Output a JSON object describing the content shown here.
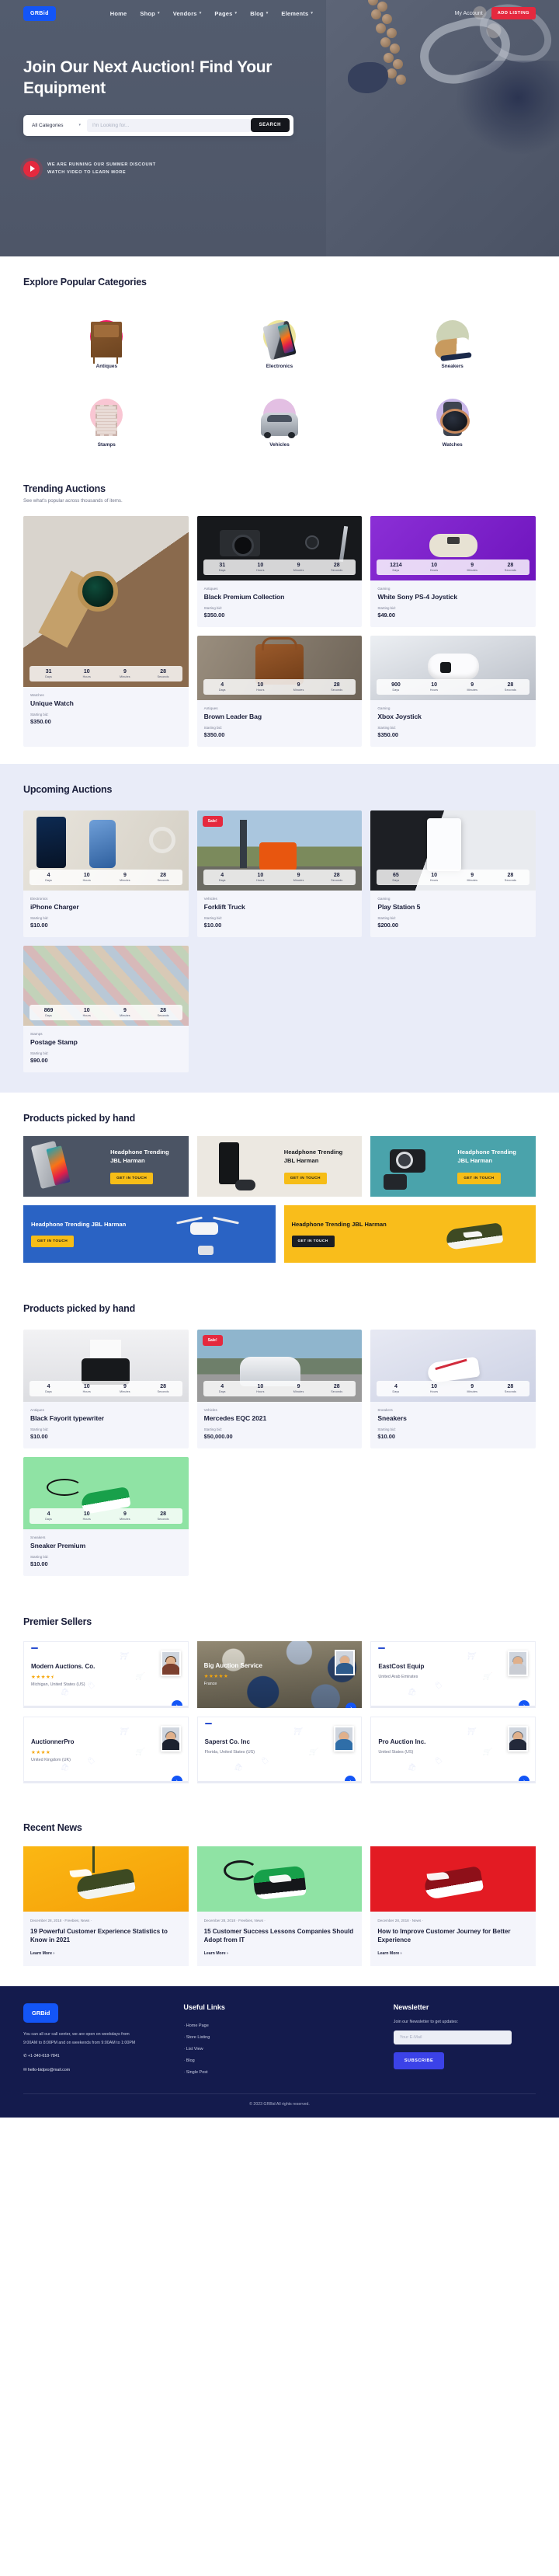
{
  "header": {
    "logo": "GRBid",
    "nav": [
      {
        "label": "Home",
        "caret": false
      },
      {
        "label": "Shop",
        "caret": true
      },
      {
        "label": "Vendors",
        "caret": true
      },
      {
        "label": "Pages",
        "caret": true
      },
      {
        "label": "Blog",
        "caret": true
      },
      {
        "label": "Elements",
        "caret": true
      }
    ],
    "account_label": "My Account",
    "add_listing_label": "ADD LISTING"
  },
  "hero": {
    "title": "Join Our Next Auction! Find Your Equipment",
    "category_select": "All Categories",
    "search_placeholder": "I'm Looking for...",
    "search_value": "",
    "search_button": "SEARCH",
    "video_line1": "WE ARE RUNNING OUR SUMMER DISCOUNT",
    "video_line2": "WATCH VIDEO TO LEARN MORE"
  },
  "categories": {
    "title": "Explore Popular Categories",
    "items": [
      {
        "label": "Antiques",
        "art": "desk",
        "blob": "#f5176a"
      },
      {
        "label": "Electronics",
        "art": "tablet",
        "blob": "#ece49a"
      },
      {
        "label": "Sneakers",
        "art": "sneaker",
        "blob": "#cdd3b6"
      },
      {
        "label": "Stamps",
        "art": "stamp",
        "blob": "#f9c6d3"
      },
      {
        "label": "Vehicles",
        "art": "car",
        "blob": "#e3bfe3"
      },
      {
        "label": "Watches",
        "art": "watch",
        "blob": "#c8b6e8"
      }
    ]
  },
  "trending": {
    "title": "Trending Auctions",
    "subtitle": "See what's popular across thousands of items.",
    "feature": {
      "media": "m-watch",
      "days": "31",
      "hours": "10",
      "minutes": "9",
      "seconds": "28",
      "category": "Watches",
      "name": "Unique Watch",
      "bid_label": "Starting bid:",
      "price": "$350.00"
    },
    "items": [
      {
        "media": "m-dark",
        "days": "31",
        "hours": "10",
        "minutes": "9",
        "seconds": "28",
        "category": "Antiques",
        "name": "Black Premium Collection",
        "bid_label": "Starting bid:",
        "price": "$350.00"
      },
      {
        "media": "m-purple",
        "days": "1214",
        "hours": "10",
        "minutes": "9",
        "seconds": "28",
        "category": "Gaming",
        "name": "White Sony PS-4 Joystick",
        "bid_label": "Starting bid:",
        "price": "$49.00"
      },
      {
        "media": "m-bag",
        "days": "4",
        "hours": "10",
        "minutes": "9",
        "seconds": "28",
        "category": "Antiques",
        "name": "Brown Leader Bag",
        "bid_label": "Starting bid:",
        "price": "$350.00"
      },
      {
        "media": "m-xbox",
        "days": "900",
        "hours": "10",
        "minutes": "9",
        "seconds": "28",
        "category": "Gaming",
        "name": "Xbox Joystick",
        "bid_label": "Starting bid:",
        "price": "$350.00"
      }
    ],
    "countdown_labels": {
      "days": "Days",
      "hours": "Hours",
      "minutes": "Minutes",
      "seconds": "Seconds"
    }
  },
  "upcoming": {
    "title": "Upcoming Auctions",
    "items": [
      {
        "media": "m-iphone",
        "sale": "",
        "days": "4",
        "hours": "10",
        "minutes": "9",
        "seconds": "28",
        "category": "Electronics",
        "name": "iPhone Charger",
        "bid_label": "Starting bid:",
        "price": "$10.00"
      },
      {
        "media": "m-fork",
        "sale": "Sale!",
        "days": "4",
        "hours": "10",
        "minutes": "9",
        "seconds": "28",
        "category": "Vehicles",
        "name": "Forklift Truck",
        "bid_label": "Starting bid:",
        "price": "$10.00"
      },
      {
        "media": "m-ps5",
        "sale": "",
        "days": "65",
        "hours": "10",
        "minutes": "9",
        "seconds": "28",
        "category": "Gaming",
        "name": "Play Station 5",
        "bid_label": "Starting bid:",
        "price": "$200.00"
      },
      {
        "media": "m-stamps",
        "sale": "",
        "days": "869",
        "hours": "10",
        "minutes": "9",
        "seconds": "28",
        "category": "Stamps",
        "name": "Postage Stamp",
        "bid_label": "Starting bid:",
        "price": "$90.00"
      }
    ]
  },
  "promo": {
    "title": "Products picked by hand",
    "top": [
      {
        "heading": "Headphone Trending JBL Harman",
        "button": "GET IN TOUCH",
        "bg": "#4b5464",
        "text": "#ffffff",
        "btn_style": "yellow",
        "art": "tablet"
      },
      {
        "heading": "Headphone Trending JBL Harman",
        "button": "GET IN TOUCH",
        "bg": "#ece8e1",
        "text": "#16181d",
        "btn_style": "yellow",
        "art": "xboxtower"
      },
      {
        "heading": "Headphone Trending JBL Harman",
        "button": "GET IN TOUCH",
        "bg": "#4aa3ab",
        "text": "#ffffff",
        "btn_style": "yellow",
        "art": "camera"
      }
    ],
    "bottom": [
      {
        "heading": "Headphone Trending JBL Harman",
        "button": "GET IN TOUCH",
        "bg": "#2a63c4",
        "text": "#ffffff",
        "btn_style": "yellow",
        "art": "drone"
      },
      {
        "heading": "Headphone Trending JBL Harman",
        "button": "GET IN TOUCH",
        "bg": "#f9bd1b",
        "text": "#16181d",
        "btn_style": "dark",
        "art": "greenshoe"
      }
    ]
  },
  "picked": {
    "title": "Products picked by hand",
    "items": [
      {
        "media": "m-typew",
        "sale": "",
        "days": "4",
        "hours": "10",
        "minutes": "9",
        "seconds": "28",
        "category": "Antiques",
        "name": "Black Fayorit typewriter",
        "bid_label": "Starting bid:",
        "price": "$10.00"
      },
      {
        "media": "m-merc",
        "sale": "Sale!",
        "days": "4",
        "hours": "10",
        "minutes": "9",
        "seconds": "28",
        "category": "Vehicles",
        "name": "Mercedes EQC 2021",
        "bid_label": "Starting bid:",
        "price": "$50,000.00"
      },
      {
        "media": "m-snk",
        "sale": "",
        "days": "4",
        "hours": "10",
        "minutes": "9",
        "seconds": "28",
        "category": "Sneakers",
        "name": "Sneakers",
        "bid_label": "Starting bid:",
        "price": "$10.00"
      },
      {
        "media": "m-green",
        "sale": "",
        "days": "4",
        "hours": "10",
        "minutes": "9",
        "seconds": "28",
        "category": "Sneakers",
        "name": "Sneaker Premium",
        "bid_label": "Starting bid:",
        "price": "$10.00"
      }
    ]
  },
  "sellers": {
    "title": "Premier Sellers",
    "items": [
      {
        "name": "Modern Auctions. Co.",
        "stars": "★★★★⯨",
        "location": "Michigan, United States (US)",
        "photo": false,
        "arrow": "›"
      },
      {
        "name": "Big Auction Service",
        "stars": "★★★★★",
        "location": "France",
        "photo": true,
        "arrow": "›"
      },
      {
        "name": "EastCost Equip",
        "stars": "",
        "location": "United Arab Emirates",
        "photo": false,
        "arrow": "›"
      },
      {
        "name": "AuctionnerPro",
        "stars": "★★★★",
        "location": "United Kingdom (UK)",
        "photo": false,
        "arrow": "›"
      },
      {
        "name": "Saperst Co. Inc",
        "stars": "",
        "location": "Florida, United States (US)",
        "photo": false,
        "arrow": "›"
      },
      {
        "name": "Pro Auction Inc.",
        "stars": "",
        "location": "United States (US)",
        "photo": false,
        "arrow": "›"
      }
    ]
  },
  "news": {
    "title": "Recent News",
    "items": [
      {
        "img": "ni-y",
        "shoe": "shoe-a",
        "meta": "December 28, 2018  ·  Freebies, News  ·",
        "title": "19 Powerful Customer Experience Statistics to Know in 2021",
        "more": "Learn More"
      },
      {
        "img": "ni-g",
        "shoe": "shoe-b",
        "meta": "December 28, 2018  ·  Freebies, News  ·",
        "title": "15 Customer Success Lessons Companies Should Adopt from IT",
        "more": "Learn More"
      },
      {
        "img": "ni-r",
        "shoe": "shoe-c",
        "meta": "December 28, 2018  ·  News  ·",
        "title": "How to Improve Customer Journey for Better Experience",
        "more": "Learn More"
      }
    ]
  },
  "footer": {
    "logo": "GRBid",
    "description": "You can all our call center, we are open on weekdays from 9:00AM to 8:00PM and on weekends from 9:00AM to 1:00PM",
    "phone": "+1-340-618-7841",
    "email": "hello-bidpro@mail.com",
    "links_title": "Useful Links",
    "links": [
      "Home Page",
      "Store Listing",
      "List View",
      "Blog",
      "Single Post"
    ],
    "newsletter_title": "Newsletter",
    "newsletter_sub": "Join our Newsletter to get updates:",
    "email_placeholder": "Your E-Mail",
    "email_value": "",
    "subscribe_label": "SUBSCRIBE",
    "copyright": "© 2023 GRBid All rights reserved."
  }
}
